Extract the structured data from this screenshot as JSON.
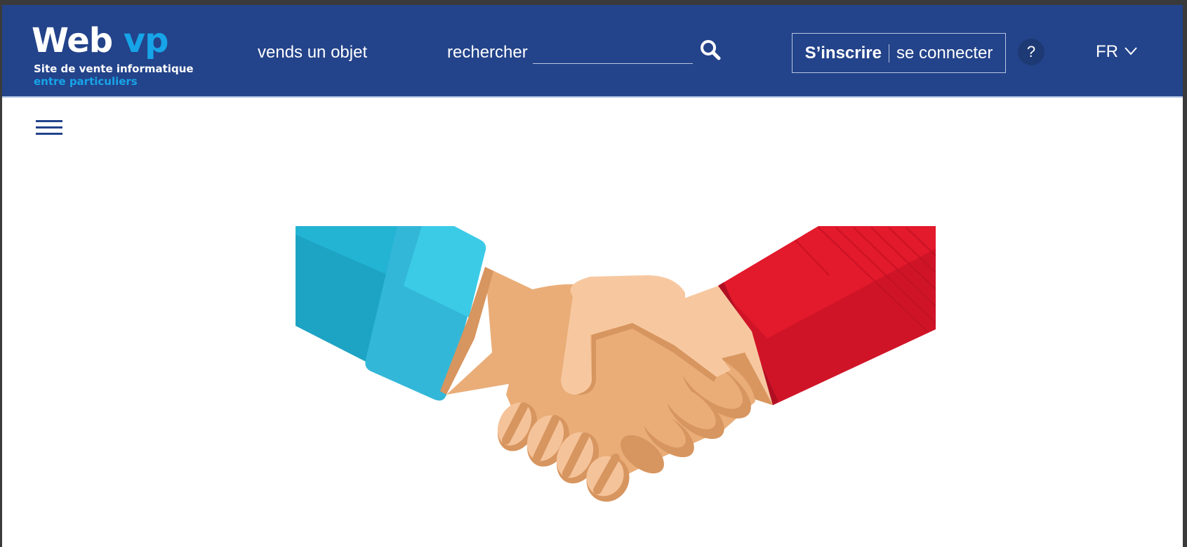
{
  "header": {
    "logo": {
      "title_main": "Web",
      "title_accent": "vp",
      "tagline_line1": "Site de vente informatique",
      "tagline_line2": "entre particuliers"
    },
    "nav_sell_label": "vends un objet",
    "search": {
      "label": "rechercher",
      "value": "",
      "placeholder": "",
      "icon": "search-icon"
    },
    "auth": {
      "signup_label": "S’inscrire",
      "login_label": "se connecter"
    },
    "help_label": "?",
    "language": {
      "selected": "FR",
      "icon": "chevron-down-icon"
    }
  },
  "menu_icon": "hamburger-menu-icon",
  "hero": {
    "illustration": "handshake-illustration"
  },
  "colors": {
    "header_bg": "#23438a",
    "logo_accent": "#17a4e8",
    "page_bg": "#ffffff",
    "hamburger": "#23438a"
  }
}
